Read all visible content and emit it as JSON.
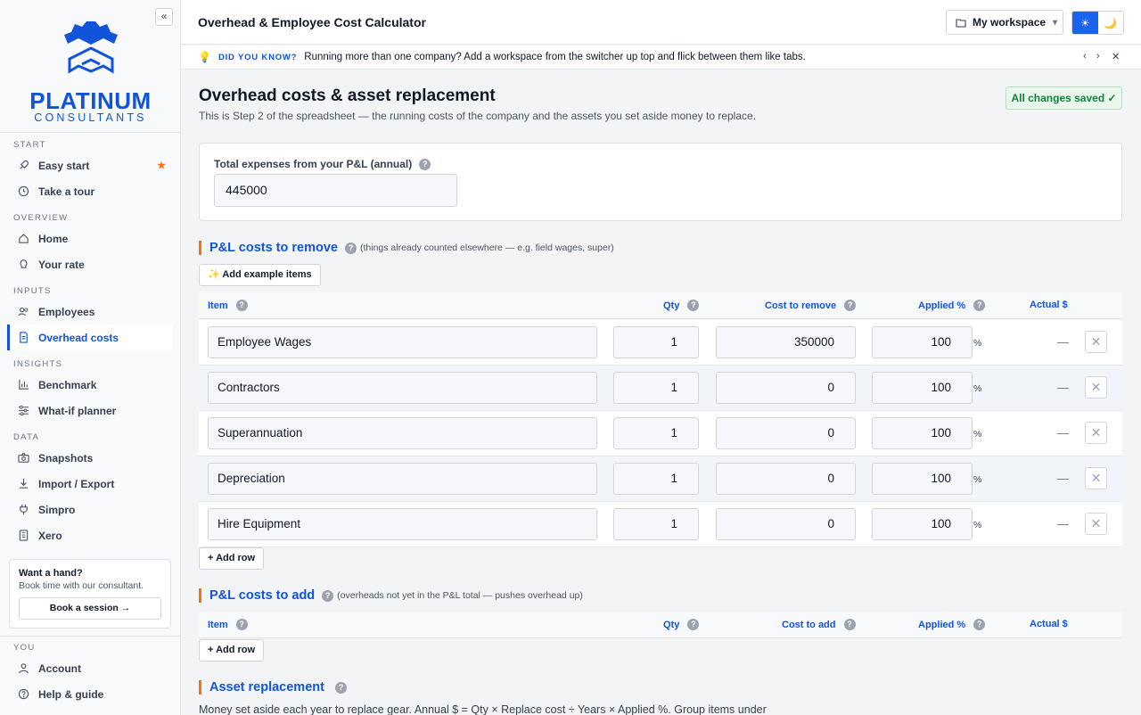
{
  "sidebar": {
    "collapse_label": "«",
    "brand_word": "PLATINUM",
    "brand_sub": "CONSULTANTS",
    "sections": {
      "start": "START",
      "overview": "OVERVIEW",
      "inputs": "INPUTS",
      "insights": "INSIGHTS",
      "data": "DATA",
      "you": "YOU"
    },
    "items": {
      "easy_start": "Easy start",
      "take_tour": "Take a tour",
      "home": "Home",
      "your_rate": "Your rate",
      "employees": "Employees",
      "overhead_costs": "Overhead costs",
      "benchmark": "Benchmark",
      "whatif": "What-if planner",
      "snapshots": "Snapshots",
      "import_export": "Import / Export",
      "simpro": "Simpro",
      "xero": "Xero",
      "account": "Account",
      "help": "Help & guide"
    },
    "star": "★",
    "help_card": {
      "title": "Want a hand?",
      "subtitle": "Book time with our consultant.",
      "button": "Book a session →"
    },
    "brand_color": "#1254d9"
  },
  "topbar": {
    "title": "Overhead & Employee Cost Calculator",
    "workspace": "My workspace",
    "workspace_chevron": "▾",
    "theme_light": "☀",
    "theme_dark": "🌙"
  },
  "tip": {
    "icon": "💡",
    "label": "DID YOU KNOW?",
    "message": "Running more than one company? Add a workspace from the switcher up top and flick between them like tabs.",
    "prev": "‹",
    "next": "›",
    "close": "✕"
  },
  "page": {
    "title": "Overhead costs & asset replacement",
    "subtitle": "This is Step 2 of the spreadsheet — the running costs of the company and the assets you set aside money to replace.",
    "saved": "All changes saved ✓"
  },
  "total": {
    "label": "Total expenses from your P&L (annual)",
    "value": "445000"
  },
  "help_glyph": "?",
  "remove": {
    "title": "P&L costs to remove",
    "note": "(things already counted elsewhere — e.g. field wages, super)",
    "example_button": "✨ Add example items",
    "headers": {
      "item": "Item",
      "qty": "Qty",
      "cost": "Cost to remove",
      "applied": "Applied %",
      "actual": "Actual $"
    },
    "rows": [
      {
        "item": "Employee Wages",
        "qty": "1",
        "cost": "350000",
        "applied": "100",
        "pct": "%",
        "actual": "—",
        "delete": "✕"
      },
      {
        "item": "Contractors",
        "qty": "1",
        "cost": "0",
        "applied": "100",
        "pct": "%",
        "actual": "—",
        "delete": "✕"
      },
      {
        "item": "Superannuation",
        "qty": "1",
        "cost": "0",
        "applied": "100",
        "pct": "%",
        "actual": "—",
        "delete": "✕"
      },
      {
        "item": "Depreciation",
        "qty": "1",
        "cost": "0",
        "applied": "100",
        "pct": "%",
        "actual": "—",
        "delete": "✕"
      },
      {
        "item": "Hire Equipment",
        "qty": "1",
        "cost": "0",
        "applied": "100",
        "pct": "%",
        "actual": "—",
        "delete": "✕"
      }
    ],
    "add_row": "+ Add row"
  },
  "add": {
    "title": "P&L costs to add",
    "note": "(overheads not yet in the P&L total — pushes overhead up)",
    "headers": {
      "item": "Item",
      "qty": "Qty",
      "cost": "Cost to add",
      "applied": "Applied %",
      "actual": "Actual $"
    },
    "add_row": "+ Add row"
  },
  "asset": {
    "title": "Asset replacement",
    "text": "Money set aside each year to replace gear. Annual $ = Qty × Replace cost ÷ Years × Applied %. Group items under"
  },
  "colors": {
    "accent": "#1254d9",
    "section_bar": "#f97316",
    "saved_green": "#15803d"
  }
}
